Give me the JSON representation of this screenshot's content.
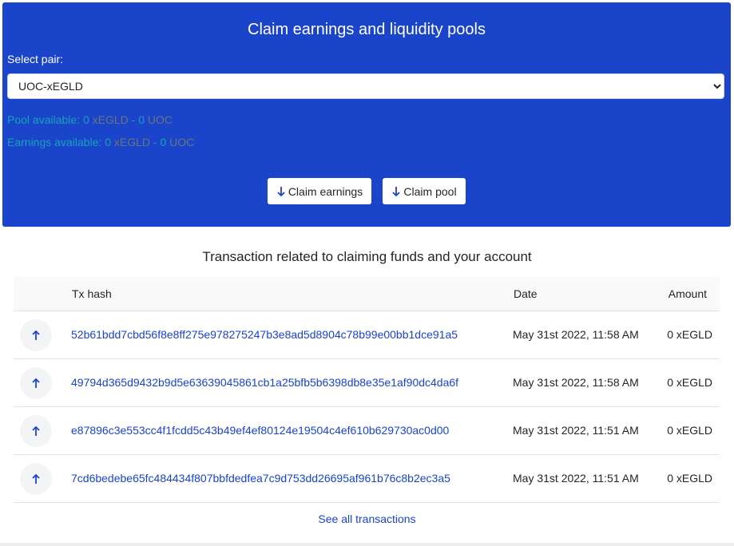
{
  "panel": {
    "title": "Claim earnings and liquidity pools",
    "select_label": "Select pair:",
    "selected_pair": "UOC-xEGLD",
    "pool": {
      "label": "Pool available: ",
      "egld": "0",
      "egld_unit": " xEGLD",
      "sep": " - ",
      "uoc": "0",
      "uoc_unit": " UOC"
    },
    "earnings": {
      "label": "Earnings available: ",
      "egld": "0",
      "egld_unit": " xEGLD",
      "sep": " - ",
      "uoc": "0",
      "uoc_unit": " UOC"
    },
    "buttons": {
      "claim_earnings": "Claim earnings",
      "claim_pool": "Claim pool"
    }
  },
  "transactions": {
    "title": "Transaction related to claiming funds and your account",
    "headers": {
      "hash": "Tx hash",
      "date": "Date",
      "amount": "Amount"
    },
    "rows": [
      {
        "hash": "52b61bdd7cbd56f8e8ff275e978275247b3e8ad5d8904c78b99e00bb1dce91a5",
        "date": "May 31st 2022, 11:58 AM",
        "amount": "0 xEGLD",
        "icon": "arrow-up-icon"
      },
      {
        "hash": "49794d365d9432b9d5e63639045861cb1a25bfb5b6398db8e35e1af90dc4da6f",
        "date": "May 31st 2022, 11:58 AM",
        "amount": "0 xEGLD",
        "icon": "arrow-up-icon"
      },
      {
        "hash": "e87896c3e553cc4f1fcdd5c43b49ef4ef80124e19504c4ef610b629730ac0d00",
        "date": "May 31st 2022, 11:51 AM",
        "amount": "0 xEGLD",
        "icon": "arrow-up-icon"
      },
      {
        "hash": "7cd6bedebe65fc484434f807bbfdedfea7c9d753dd26695af961b76c8b2ec3a5",
        "date": "May 31st 2022, 11:51 AM",
        "amount": "0 xEGLD",
        "icon": "arrow-up-icon"
      }
    ],
    "see_all": "See all transactions"
  },
  "colors": {
    "panel_bg": "#1a44c9",
    "link": "#1a44c9",
    "info": "#17a2b8",
    "muted": "#6c757d"
  }
}
